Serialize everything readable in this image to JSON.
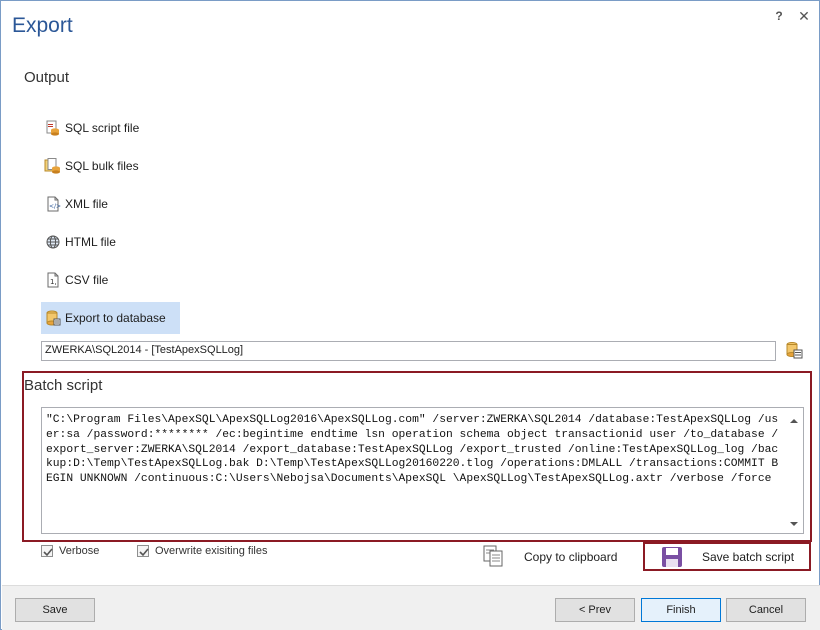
{
  "window": {
    "title": "Export",
    "help_label": "?",
    "close_label": "✕"
  },
  "output": {
    "heading": "Output",
    "options": [
      {
        "label": "SQL script file",
        "icon": "sql-script-icon",
        "selected": false
      },
      {
        "label": "SQL bulk files",
        "icon": "sql-bulk-icon",
        "selected": false
      },
      {
        "label": "XML file",
        "icon": "xml-file-icon",
        "selected": false
      },
      {
        "label": "HTML file",
        "icon": "html-globe-icon",
        "selected": false
      },
      {
        "label": "CSV file",
        "icon": "csv-file-icon",
        "selected": false
      },
      {
        "label": "Export to database",
        "icon": "database-icon",
        "selected": true
      }
    ],
    "database_value": "ZWERKA\\SQL2014 - [TestApexSQLLog]"
  },
  "batch": {
    "heading": "Batch script",
    "script": "\"C:\\Program Files\\ApexSQL\\ApexSQLLog2016\\ApexSQLLog.com\" /server:ZWERKA\\SQL2014 /database:TestApexSQLLog /user:sa /password:******** /ec:begintime endtime lsn operation schema object transactionid user /to_database /export_server:ZWERKA\\SQL2014 /export_database:TestApexSQLLog /export_trusted /online:TestApexSQLLog_log /backup:D:\\Temp\\TestApexSQLLog.bak D:\\Temp\\TestApexSQLLog20160220.tlog /operations:DMLALL /transactions:COMMIT BEGIN UNKNOWN /continuous:C:\\Users\\Nebojsa\\Documents\\ApexSQL \\ApexSQLLog\\TestApexSQLLog.axtr /verbose /force"
  },
  "options": {
    "verbose_label": "Verbose",
    "verbose_checked": true,
    "overwrite_label": "Overwrite exisiting files",
    "overwrite_checked": true,
    "copy_label": "Copy to clipboard",
    "save_batch_label": "Save batch script"
  },
  "footer": {
    "save_label": "Save",
    "prev_label": "< Prev",
    "finish_label": "Finish",
    "cancel_label": "Cancel"
  },
  "colors": {
    "accent": "#2b5797",
    "highlight_border": "#8b1a24",
    "selected_bg": "#cde0f7"
  }
}
